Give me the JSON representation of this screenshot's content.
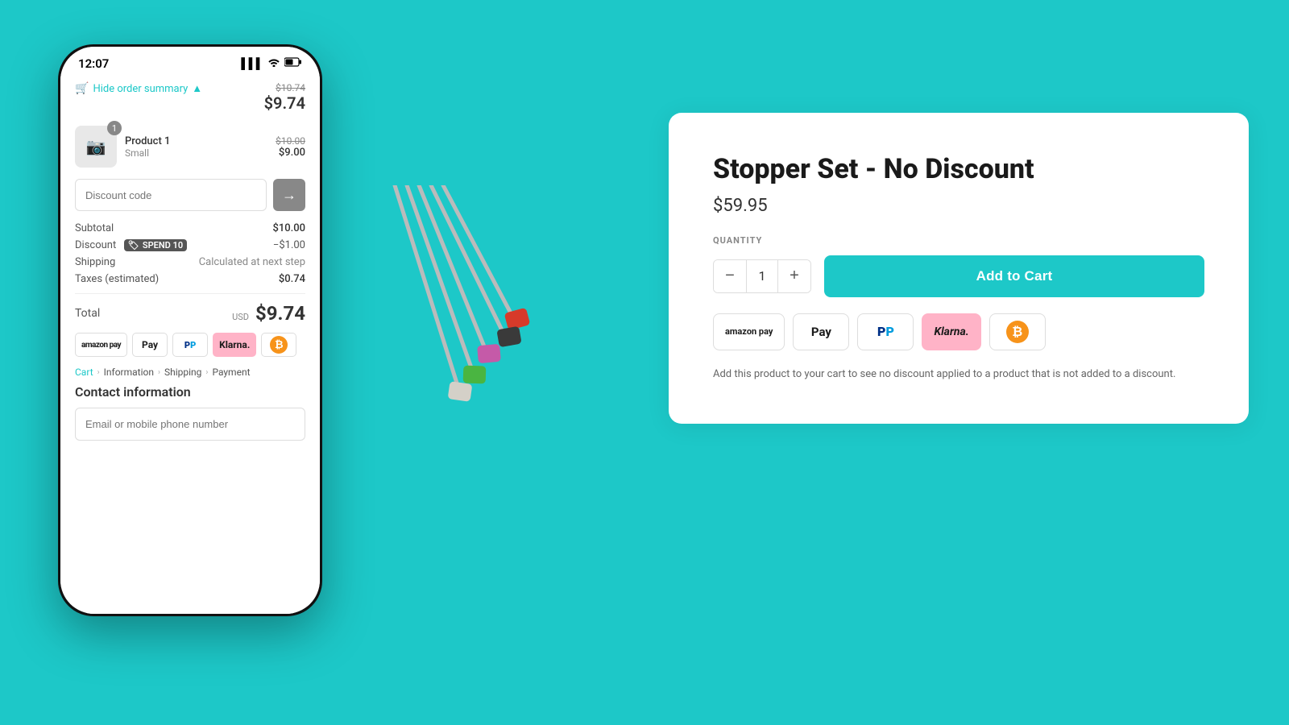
{
  "background": "#1dc8c8",
  "phone": {
    "status": {
      "time": "12:07",
      "signal": "▌▌▌",
      "wifi": "WiFi",
      "battery": "🔋"
    },
    "order": {
      "hide_label": "Hide order summary",
      "original_price": "$10.74",
      "current_price": "$9.74"
    },
    "product": {
      "name": "Product 1",
      "variant": "Small",
      "original_price": "$10.00",
      "current_price": "$9.00",
      "badge": "1"
    },
    "discount": {
      "placeholder": "Discount code",
      "button_arrow": "→"
    },
    "pricing": {
      "subtotal_label": "Subtotal",
      "subtotal_value": "$10.00",
      "discount_label": "Discount",
      "discount_code": "SPEND 10",
      "discount_value": "−$1.00",
      "shipping_label": "Shipping",
      "shipping_value": "Calculated at next step",
      "taxes_label": "Taxes (estimated)",
      "taxes_value": "$0.74"
    },
    "total": {
      "label": "Total",
      "currency": "USD",
      "amount": "$9.74"
    },
    "payment_icons": [
      {
        "id": "amazon",
        "label": "amazon pay"
      },
      {
        "id": "apple",
        "label": "Apple Pay"
      },
      {
        "id": "paypal",
        "label": "PayPal"
      },
      {
        "id": "klarna",
        "label": "Klarna."
      },
      {
        "id": "bitcoin",
        "label": "₿"
      }
    ],
    "breadcrumb": [
      {
        "label": "Cart",
        "link": true
      },
      {
        "label": "Information",
        "link": false
      },
      {
        "label": "Shipping",
        "link": false
      },
      {
        "label": "Payment",
        "link": false
      }
    ],
    "contact": {
      "title": "Contact information",
      "email_placeholder": "Email or mobile phone number"
    }
  },
  "product_card": {
    "title": "Stopper Set - No Discount",
    "price": "$59.95",
    "quantity_label": "QUANTITY",
    "quantity": 1,
    "add_to_cart": "Add to Cart",
    "description": "Add this product to your cart to see no discount applied to a product that is not added to a discount.",
    "payment_icons": [
      {
        "id": "amazon",
        "label": "amazon pay"
      },
      {
        "id": "apple",
        "label": "Apple Pay"
      },
      {
        "id": "paypal",
        "label": "PayPal"
      },
      {
        "id": "klarna",
        "label": "Klarna."
      },
      {
        "id": "bitcoin",
        "label": "₿"
      }
    ]
  }
}
